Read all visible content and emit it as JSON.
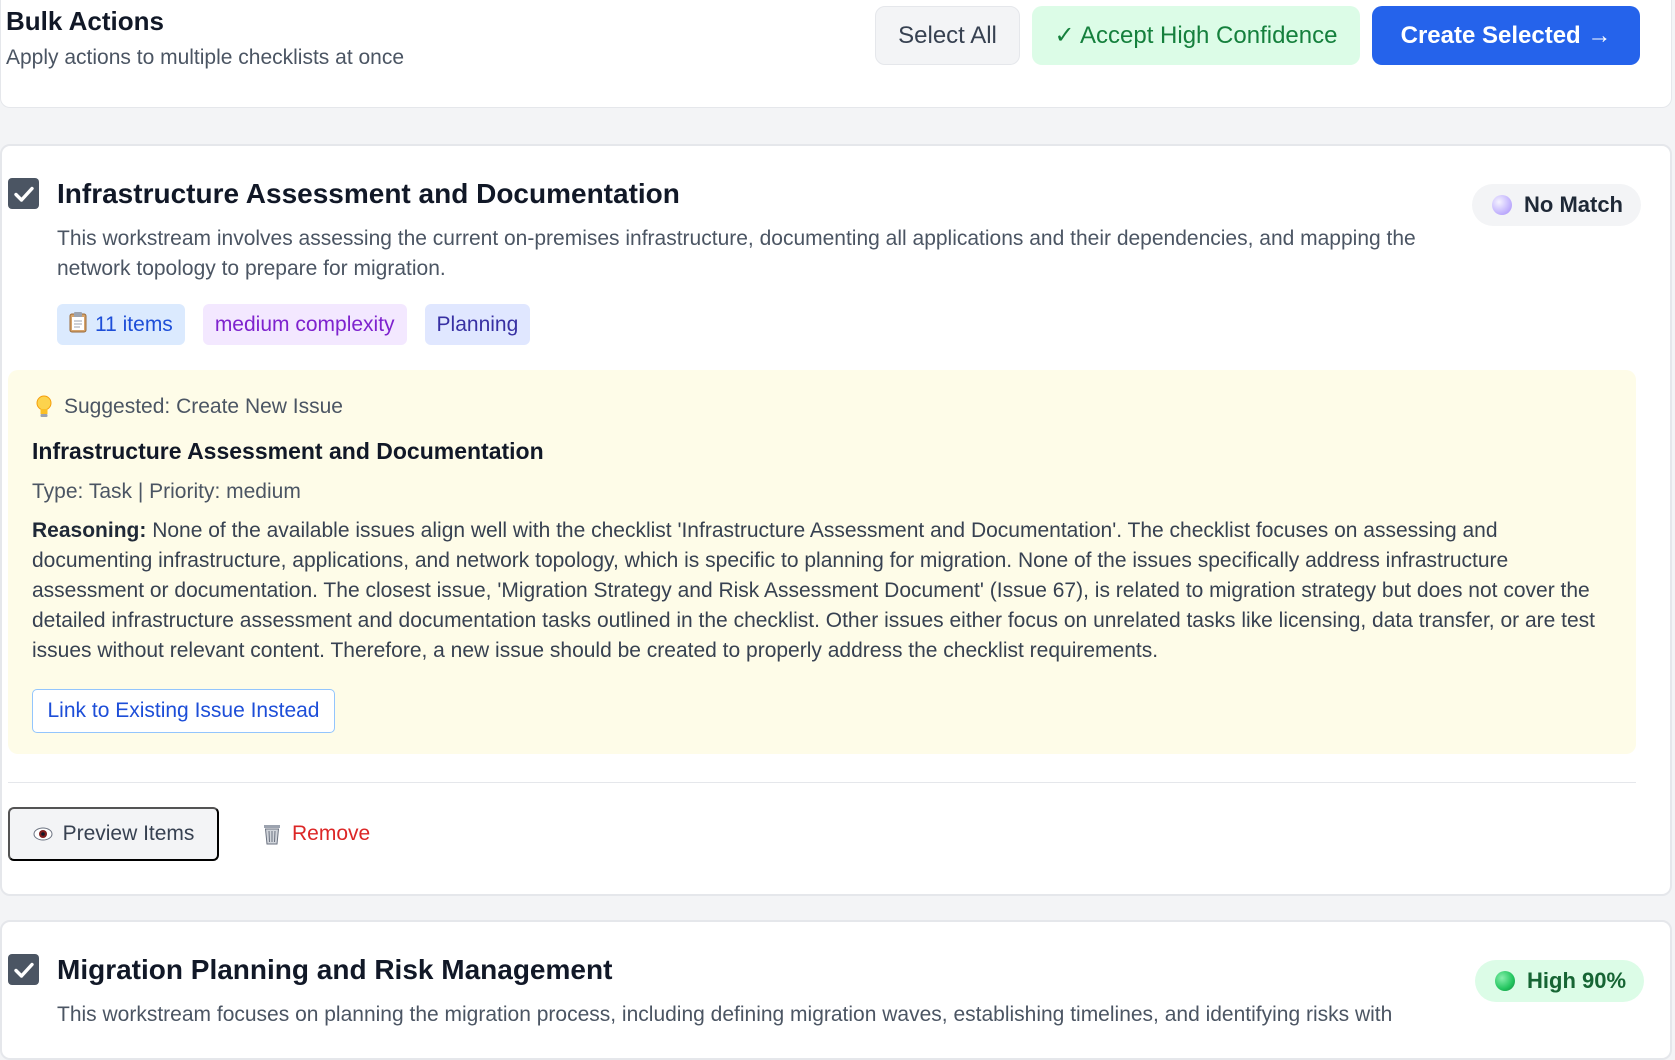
{
  "header": {
    "title": "Bulk Actions",
    "subtitle": "Apply actions to multiple checklists at once",
    "select_all_label": "Select All",
    "accept_label": "✓ Accept High Confidence",
    "create_label": "Create Selected →"
  },
  "cards": [
    {
      "checked": true,
      "title": "Infrastructure Assessment and Documentation",
      "description": "This workstream involves assessing the current on-premises infrastructure, documenting all applications and their dependencies, and mapping the network topology to prepare for migration.",
      "match_label": "No Match",
      "tags": {
        "items": "11 items",
        "complexity": "medium complexity",
        "phase": "Planning"
      },
      "suggestion": {
        "heading": "Suggested: Create New Issue",
        "title": "Infrastructure Assessment and Documentation",
        "meta": "Type: Task | Priority: medium",
        "reasoning_label": "Reasoning:",
        "reasoning": "None of the available issues align well with the checklist 'Infrastructure Assessment and Documentation'. The checklist focuses on assessing and documenting infrastructure, applications, and network topology, which is specific to planning for migration. None of the issues specifically address infrastructure assessment or documentation. The closest issue, 'Migration Strategy and Risk Assessment Document' (Issue 67), is related to migration strategy but does not cover the detailed infrastructure assessment and documentation tasks outlined in the checklist. Other issues either focus on unrelated tasks like licensing, data transfer, or are test issues without relevant content. Therefore, a new issue should be created to properly address the checklist requirements.",
        "link_label": "Link to Existing Issue Instead"
      },
      "preview_label": "Preview Items",
      "remove_label": "Remove"
    },
    {
      "checked": true,
      "title": "Migration Planning and Risk Management",
      "description": "This workstream focuses on planning the migration process, including defining migration waves, establishing timelines, and identifying risks with",
      "match_label": "High 90%"
    }
  ],
  "colors": {
    "primary": "#2563eb",
    "success": "#15803d",
    "danger": "#dc2626",
    "suggestion_bg": "#fefce8"
  },
  "icons": {
    "checkbox": "check-icon",
    "items_tag": "clipboard-icon",
    "suggestion": "lightbulb-icon",
    "preview": "eye-icon",
    "remove": "trash-icon",
    "no_match": "purple-dot-icon",
    "high": "green-dot-icon"
  }
}
